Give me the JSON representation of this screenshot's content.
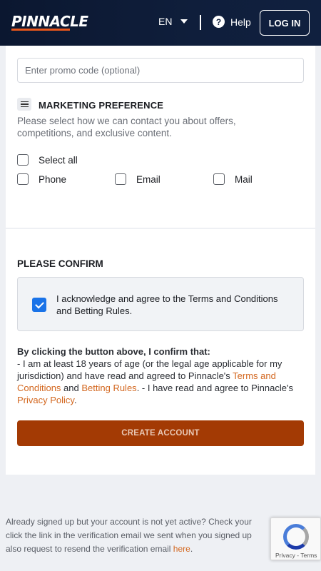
{
  "header": {
    "logo": "PINNACLE",
    "language": "EN",
    "help_label": "Help",
    "login_label": "LOG IN"
  },
  "form": {
    "promo_placeholder": "Enter promo code (optional)",
    "marketing": {
      "title": "MARKETING PREFERENCE",
      "description": "Please select how we can contact you about offers, competitions, and exclusive content.",
      "options": {
        "select_all": "Select all",
        "phone": "Phone",
        "email": "Email",
        "mail": "Mail"
      }
    }
  },
  "confirm": {
    "title": "PLEASE CONFIRM",
    "acknowledge_text": "I acknowledge and agree to the Terms and Conditions and Betting Rules.",
    "acknowledge_checked": true,
    "intro": "By clicking the button above, I confirm that:",
    "statement_part1": "- I am at least 18 years of age (or the legal age applicable for my jurisdiction) and have read and agreed to Pinnacle's ",
    "terms_link": "Terms and Conditions",
    "and_text": " and ",
    "betting_rules_link": "Betting Rules",
    "statement_part2": ". - I have read and agree to Pinnacle's ",
    "privacy_link": "Privacy Policy",
    "period": ".",
    "create_button": "CREATE ACCOUNT"
  },
  "footer": {
    "line1": "Already signed up but your account is not yet active? Check your",
    "line2": "click the link in the verification email we sent when you signed up",
    "line3_prefix": "also request to resend the verification email ",
    "here_link": "here",
    "line3_suffix": "."
  },
  "recaptcha": {
    "text": "Privacy - Terms"
  },
  "colors": {
    "header_bg": "#0f1e3b",
    "accent_orange": "#d3671f",
    "create_button_bg": "#a33a04",
    "checkbox_checked": "#1a73e8"
  }
}
